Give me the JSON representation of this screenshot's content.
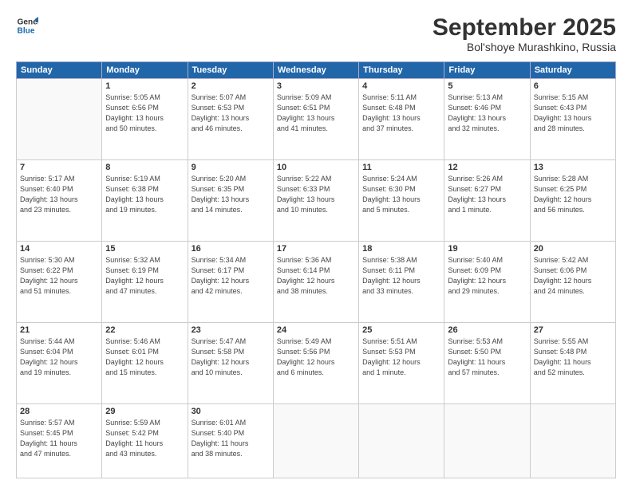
{
  "header": {
    "logo_line1": "General",
    "logo_line2": "Blue",
    "month": "September 2025",
    "location": "Bol'shoye Murashkino, Russia"
  },
  "weekdays": [
    "Sunday",
    "Monday",
    "Tuesday",
    "Wednesday",
    "Thursday",
    "Friday",
    "Saturday"
  ],
  "weeks": [
    [
      {
        "day": "",
        "info": ""
      },
      {
        "day": "1",
        "info": "Sunrise: 5:05 AM\nSunset: 6:56 PM\nDaylight: 13 hours\nand 50 minutes."
      },
      {
        "day": "2",
        "info": "Sunrise: 5:07 AM\nSunset: 6:53 PM\nDaylight: 13 hours\nand 46 minutes."
      },
      {
        "day": "3",
        "info": "Sunrise: 5:09 AM\nSunset: 6:51 PM\nDaylight: 13 hours\nand 41 minutes."
      },
      {
        "day": "4",
        "info": "Sunrise: 5:11 AM\nSunset: 6:48 PM\nDaylight: 13 hours\nand 37 minutes."
      },
      {
        "day": "5",
        "info": "Sunrise: 5:13 AM\nSunset: 6:46 PM\nDaylight: 13 hours\nand 32 minutes."
      },
      {
        "day": "6",
        "info": "Sunrise: 5:15 AM\nSunset: 6:43 PM\nDaylight: 13 hours\nand 28 minutes."
      }
    ],
    [
      {
        "day": "7",
        "info": "Sunrise: 5:17 AM\nSunset: 6:40 PM\nDaylight: 13 hours\nand 23 minutes."
      },
      {
        "day": "8",
        "info": "Sunrise: 5:19 AM\nSunset: 6:38 PM\nDaylight: 13 hours\nand 19 minutes."
      },
      {
        "day": "9",
        "info": "Sunrise: 5:20 AM\nSunset: 6:35 PM\nDaylight: 13 hours\nand 14 minutes."
      },
      {
        "day": "10",
        "info": "Sunrise: 5:22 AM\nSunset: 6:33 PM\nDaylight: 13 hours\nand 10 minutes."
      },
      {
        "day": "11",
        "info": "Sunrise: 5:24 AM\nSunset: 6:30 PM\nDaylight: 13 hours\nand 5 minutes."
      },
      {
        "day": "12",
        "info": "Sunrise: 5:26 AM\nSunset: 6:27 PM\nDaylight: 13 hours\nand 1 minute."
      },
      {
        "day": "13",
        "info": "Sunrise: 5:28 AM\nSunset: 6:25 PM\nDaylight: 12 hours\nand 56 minutes."
      }
    ],
    [
      {
        "day": "14",
        "info": "Sunrise: 5:30 AM\nSunset: 6:22 PM\nDaylight: 12 hours\nand 51 minutes."
      },
      {
        "day": "15",
        "info": "Sunrise: 5:32 AM\nSunset: 6:19 PM\nDaylight: 12 hours\nand 47 minutes."
      },
      {
        "day": "16",
        "info": "Sunrise: 5:34 AM\nSunset: 6:17 PM\nDaylight: 12 hours\nand 42 minutes."
      },
      {
        "day": "17",
        "info": "Sunrise: 5:36 AM\nSunset: 6:14 PM\nDaylight: 12 hours\nand 38 minutes."
      },
      {
        "day": "18",
        "info": "Sunrise: 5:38 AM\nSunset: 6:11 PM\nDaylight: 12 hours\nand 33 minutes."
      },
      {
        "day": "19",
        "info": "Sunrise: 5:40 AM\nSunset: 6:09 PM\nDaylight: 12 hours\nand 29 minutes."
      },
      {
        "day": "20",
        "info": "Sunrise: 5:42 AM\nSunset: 6:06 PM\nDaylight: 12 hours\nand 24 minutes."
      }
    ],
    [
      {
        "day": "21",
        "info": "Sunrise: 5:44 AM\nSunset: 6:04 PM\nDaylight: 12 hours\nand 19 minutes."
      },
      {
        "day": "22",
        "info": "Sunrise: 5:46 AM\nSunset: 6:01 PM\nDaylight: 12 hours\nand 15 minutes."
      },
      {
        "day": "23",
        "info": "Sunrise: 5:47 AM\nSunset: 5:58 PM\nDaylight: 12 hours\nand 10 minutes."
      },
      {
        "day": "24",
        "info": "Sunrise: 5:49 AM\nSunset: 5:56 PM\nDaylight: 12 hours\nand 6 minutes."
      },
      {
        "day": "25",
        "info": "Sunrise: 5:51 AM\nSunset: 5:53 PM\nDaylight: 12 hours\nand 1 minute."
      },
      {
        "day": "26",
        "info": "Sunrise: 5:53 AM\nSunset: 5:50 PM\nDaylight: 11 hours\nand 57 minutes."
      },
      {
        "day": "27",
        "info": "Sunrise: 5:55 AM\nSunset: 5:48 PM\nDaylight: 11 hours\nand 52 minutes."
      }
    ],
    [
      {
        "day": "28",
        "info": "Sunrise: 5:57 AM\nSunset: 5:45 PM\nDaylight: 11 hours\nand 47 minutes."
      },
      {
        "day": "29",
        "info": "Sunrise: 5:59 AM\nSunset: 5:42 PM\nDaylight: 11 hours\nand 43 minutes."
      },
      {
        "day": "30",
        "info": "Sunrise: 6:01 AM\nSunset: 5:40 PM\nDaylight: 11 hours\nand 38 minutes."
      },
      {
        "day": "",
        "info": ""
      },
      {
        "day": "",
        "info": ""
      },
      {
        "day": "",
        "info": ""
      },
      {
        "day": "",
        "info": ""
      }
    ]
  ]
}
